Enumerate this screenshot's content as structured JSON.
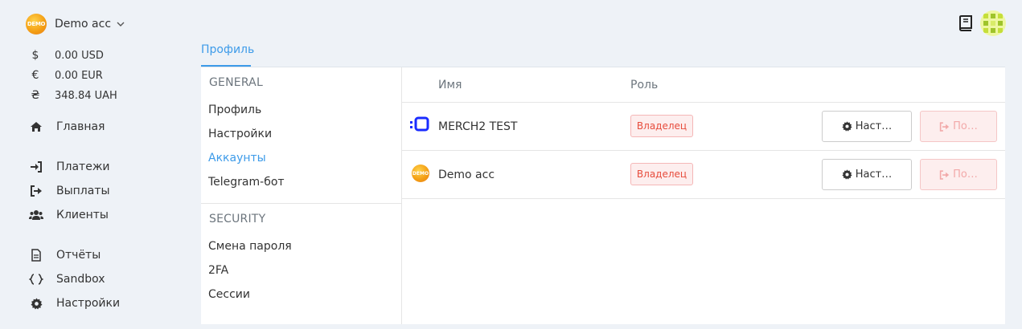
{
  "account": {
    "name": "Demo acc",
    "logo_text": "DEMO"
  },
  "balances": [
    {
      "symbol": "$",
      "value": "0.00 USD"
    },
    {
      "symbol": "€",
      "value": "0.00 EUR"
    },
    {
      "symbol": "₴",
      "value": "348.84 UAH"
    }
  ],
  "nav": {
    "home": "Главная",
    "payments": "Платежи",
    "payouts": "Выплаты",
    "clients": "Клиенты",
    "reports": "Отчёты",
    "sandbox": "Sandbox",
    "settings": "Настройки"
  },
  "tabs": {
    "profile": "Профиль"
  },
  "settings_menu": {
    "general_header": "GENERAL",
    "general_items": [
      "Профиль",
      "Настройки",
      "Аккаунты",
      "Telegram-бот"
    ],
    "active_item": "Аккаунты",
    "security_header": "SECURITY",
    "security_items": [
      "Смена пароля",
      "2FA",
      "Сессии"
    ]
  },
  "accounts_table": {
    "headers": {
      "name": "Имя",
      "role": "Роль"
    },
    "rows": [
      {
        "logo": "merch-logo",
        "name": "MERCH2 TEST",
        "role": "Владелец",
        "settings_label": "Наст…",
        "exit_label": "По…"
      },
      {
        "logo": "demo-logo",
        "logo_text": "DEMO",
        "name": "Demo acc",
        "role": "Владелец",
        "settings_label": "Наст…",
        "exit_label": "По…"
      }
    ]
  },
  "colors": {
    "accent": "#3d9be9",
    "badge_red": "#e74c3c",
    "background": "#eef2f7"
  }
}
